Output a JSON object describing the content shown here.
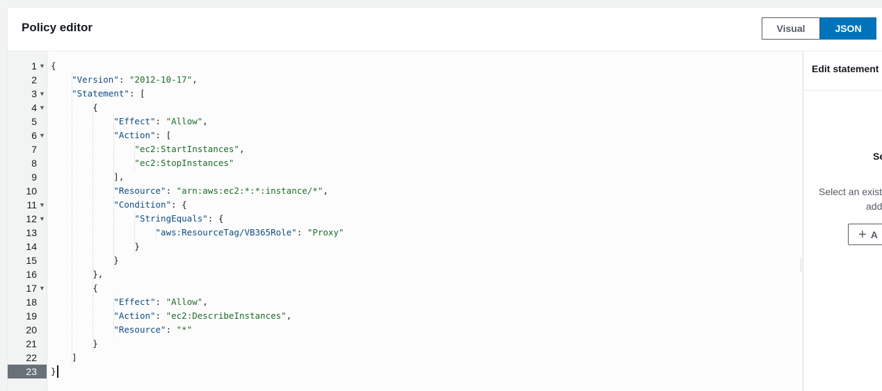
{
  "header": {
    "title": "Policy editor",
    "tabs": [
      {
        "label": "Visual",
        "selected": false
      },
      {
        "label": "JSON",
        "selected": true
      }
    ]
  },
  "editor": {
    "language": "json",
    "active_line": 23,
    "fold_lines": [
      1,
      3,
      4,
      6,
      11,
      12,
      17
    ],
    "lines": [
      "{",
      "    \"Version\": \"2012-10-17\",",
      "    \"Statement\": [",
      "        {",
      "            \"Effect\": \"Allow\",",
      "            \"Action\": [",
      "                \"ec2:StartInstances\",",
      "                \"ec2:StopInstances\"",
      "            ],",
      "            \"Resource\": \"arn:aws:ec2:*:*:instance/*\",",
      "            \"Condition\": {",
      "                \"StringEquals\": {",
      "                    \"aws:ResourceTag/VB365Role\": \"Proxy\"",
      "                }",
      "            }",
      "        },",
      "        {",
      "            \"Effect\": \"Allow\",",
      "            \"Action\": \"ec2:DescribeInstances\",",
      "            \"Resource\": \"*\"",
      "        }",
      "    ]",
      "}"
    ]
  },
  "side_panel": {
    "title": "Edit statement",
    "body_title": "Se",
    "description_line1": "Select an existi",
    "description_line2": "add",
    "add_button_label": "A"
  },
  "colors": {
    "accent": "#0073bb",
    "key": "#0f4c81",
    "string": "#1d6b2b",
    "active_line_bg": "#687078"
  }
}
